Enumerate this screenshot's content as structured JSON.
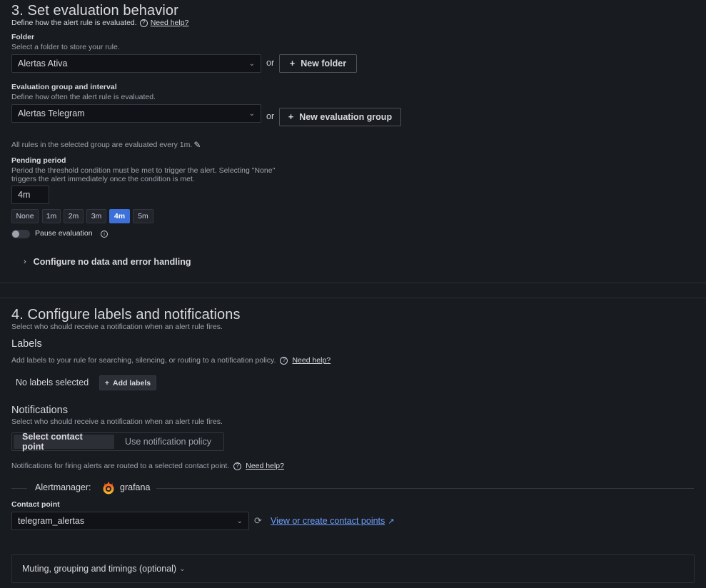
{
  "section3": {
    "title": "3. Set evaluation behavior",
    "description": "Define how the alert rule is evaluated.",
    "need_help": "Need help?",
    "folder": {
      "label": "Folder",
      "description": "Select a folder to store your rule.",
      "value": "Alertas Ativa",
      "or": "or",
      "new_button": "New folder"
    },
    "group": {
      "label": "Evaluation group and interval",
      "description": "Define how often the alert rule is evaluated.",
      "value": "Alertas Telegram",
      "or": "or",
      "new_button": "New evaluation group",
      "note": "All rules in the selected group are evaluated every 1m."
    },
    "pending": {
      "label": "Pending period",
      "description_line1": "Period the threshold condition must be met to trigger the alert. Selecting \"None\"",
      "description_line2": "triggers the alert immediately once the condition is met.",
      "value": "4m",
      "options": [
        "None",
        "1m",
        "2m",
        "3m",
        "4m",
        "5m"
      ],
      "selected": "4m"
    },
    "pause": {
      "label": "Pause evaluation",
      "enabled": false
    },
    "no_data": "Configure no data and error handling"
  },
  "section4": {
    "title": "4. Configure labels and notifications",
    "description": "Select who should receive a notification when an alert rule fires.",
    "labels": {
      "heading": "Labels",
      "description": "Add labels to your rule for searching, silencing, or routing to a notification policy.",
      "need_help": "Need help?",
      "empty": "No labels selected",
      "add_button": "Add labels"
    },
    "notifications": {
      "heading": "Notifications",
      "description": "Select who should receive a notification when an alert rule fires.",
      "tabs": [
        "Select contact point",
        "Use notification policy"
      ],
      "active_tab": "Select contact point",
      "routing_note": "Notifications for firing alerts are routed to a selected contact point.",
      "need_help": "Need help?",
      "alertmanager_label": "Alertmanager:",
      "alertmanager_value": "grafana",
      "contact_label": "Contact point",
      "contact_value": "telegram_alertas",
      "view_link": "View or create contact points"
    },
    "muting": "Muting, grouping and timings (optional)"
  },
  "colors": {
    "background": "#181b1f",
    "accent": "#3d71d9",
    "link": "#6e9fff"
  }
}
